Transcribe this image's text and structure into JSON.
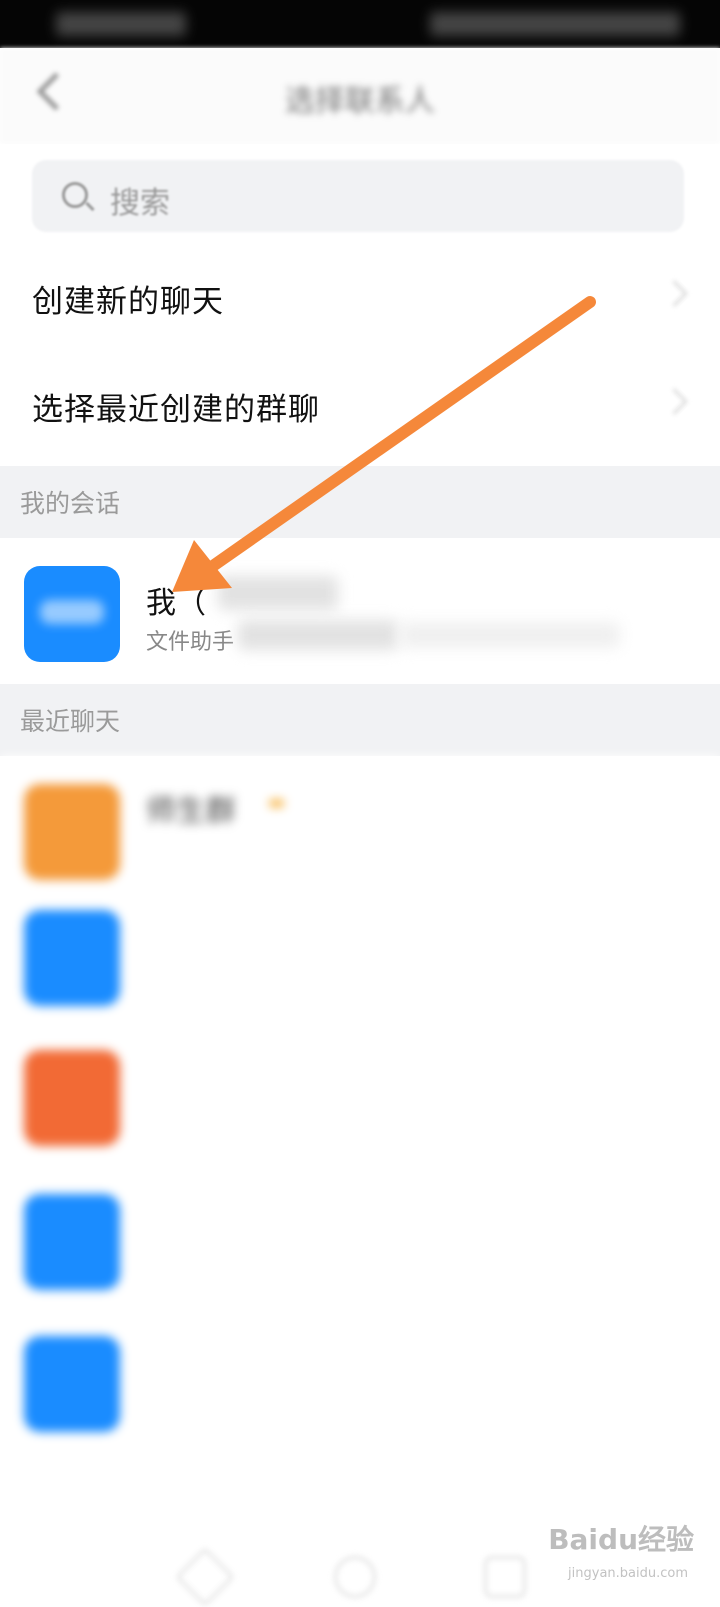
{
  "header": {
    "title": "选择联系人",
    "back_icon": "chevron-left-icon"
  },
  "search": {
    "placeholder": "搜索",
    "icon": "search-icon"
  },
  "actions": [
    {
      "label": "创建新的聊天"
    },
    {
      "label": "选择最近创建的群聊"
    }
  ],
  "sections": {
    "my_chats": "我的会话",
    "recent": "最近聊天"
  },
  "my_chat": {
    "name": "我（",
    "subtitle": "文件助手",
    "avatar_color": "#1a8cff"
  },
  "recent_chats": [
    {
      "name": "师生群",
      "subtitle": "",
      "avatar_color": "#f49a3a"
    },
    {
      "name": "",
      "subtitle": "",
      "avatar_color": "#1a8cff"
    },
    {
      "name": "",
      "subtitle": "",
      "avatar_color": "#f26a35"
    },
    {
      "name": "",
      "subtitle": "",
      "avatar_color": "#1a8cff"
    },
    {
      "name": "",
      "subtitle": "",
      "avatar_color": "#1a8cff"
    }
  ],
  "annotation": {
    "arrow_color": "#f5883a"
  },
  "watermark": {
    "brand": "Baidu经验",
    "url": "jingyan.baidu.com"
  }
}
